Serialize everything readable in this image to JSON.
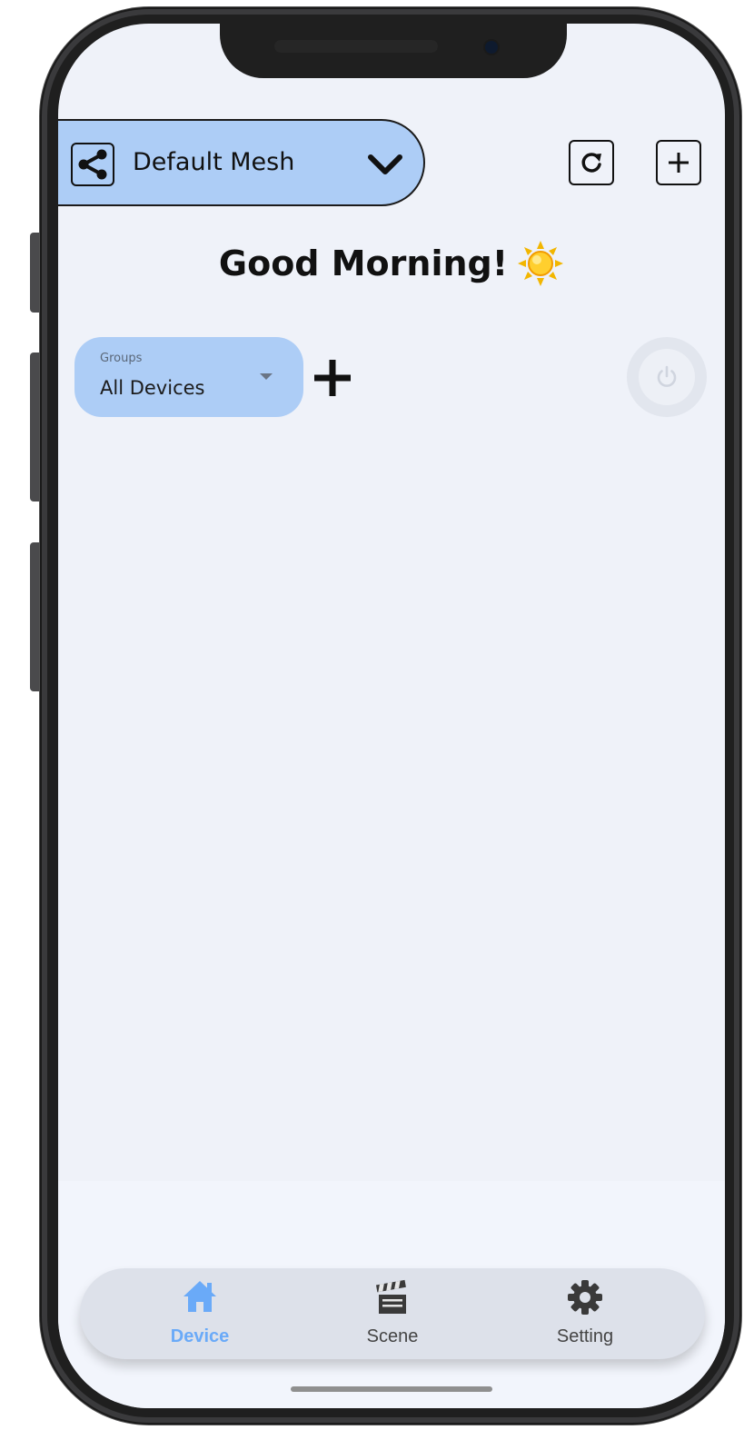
{
  "header": {
    "mesh_name": "Default Mesh",
    "icons": {
      "mesh": "share-icon",
      "dropdown": "chevron-down-icon",
      "refresh": "refresh-icon",
      "add": "plus-icon"
    }
  },
  "greeting": {
    "text": "Good Morning!",
    "icon": "sun-icon"
  },
  "groups": {
    "caption": "Groups",
    "selected": "All Devices",
    "add_icon": "plus-icon",
    "power_icon": "power-icon"
  },
  "nav": {
    "items": [
      {
        "label": "Device",
        "icon": "home-icon",
        "active": true
      },
      {
        "label": "Scene",
        "icon": "clapperboard-icon",
        "active": false
      },
      {
        "label": "Setting",
        "icon": "gear-icon",
        "active": false
      }
    ]
  },
  "colors": {
    "screen_bg": "#eff2f9",
    "accent_light": "#adcdf6",
    "nav_active": "#6aaaf8",
    "nav_bg": "#dde1ea"
  }
}
